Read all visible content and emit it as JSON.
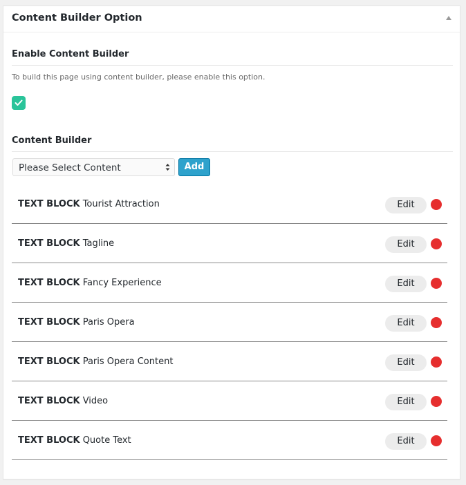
{
  "metabox": {
    "title": "Content Builder Option"
  },
  "enable_section": {
    "heading": "Enable Content Builder",
    "help_text": "To build this page using content builder, please enable this option.",
    "checked": true
  },
  "builder_section": {
    "heading": "Content Builder",
    "select_value": "Please Select Content",
    "add_label": "Add"
  },
  "blocks": [
    {
      "type": "TEXT BLOCK",
      "name": "Tourist Attraction",
      "edit_label": "Edit"
    },
    {
      "type": "TEXT BLOCK",
      "name": "Tagline",
      "edit_label": "Edit"
    },
    {
      "type": "TEXT BLOCK",
      "name": "Fancy Experience",
      "edit_label": "Edit"
    },
    {
      "type": "TEXT BLOCK",
      "name": "Paris Opera",
      "edit_label": "Edit"
    },
    {
      "type": "TEXT BLOCK",
      "name": "Paris Opera Content",
      "edit_label": "Edit"
    },
    {
      "type": "TEXT BLOCK",
      "name": "Video",
      "edit_label": "Edit"
    },
    {
      "type": "TEXT BLOCK",
      "name": "Quote Text",
      "edit_label": "Edit"
    }
  ],
  "colors": {
    "accent_checkbox": "#2ac49a",
    "add_button": "#2ea2cc",
    "remove_dot": "#e62e2e"
  },
  "icons": {
    "collapse": "triangle-up-icon",
    "checkbox": "checkmark-icon",
    "select": "select-arrows-icon",
    "remove": "red-dot-icon"
  }
}
